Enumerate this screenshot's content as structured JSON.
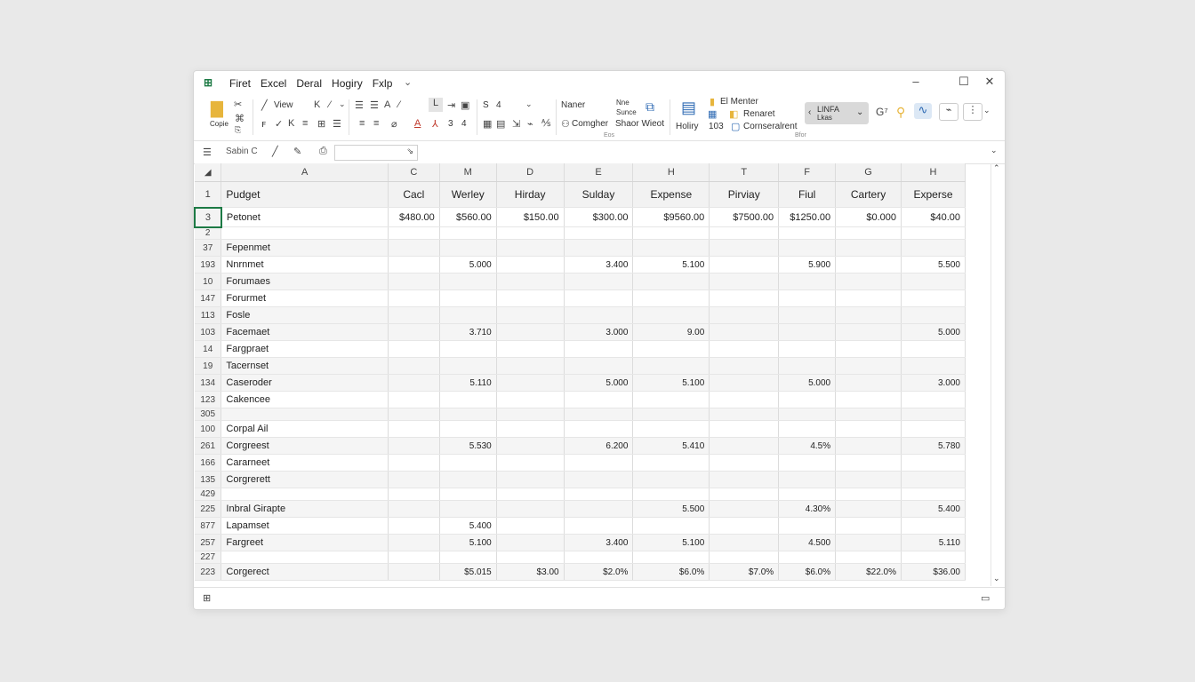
{
  "window": {
    "menu": [
      "Firet",
      "Excel",
      "Deral",
      "Hogiry",
      "Fxlp"
    ],
    "controls": [
      "–",
      "☐",
      "✕"
    ]
  },
  "ribbon": {
    "clipboard_label": "Copie",
    "view_label": "View",
    "name_label": "Naner",
    "computer_label": "Comgher",
    "nine_label": "Nne",
    "share_label": "Sunce",
    "sharewb_label": "Shaor Wieot",
    "holiry_label": "Holiry",
    "num_label": "103",
    "font_nums": [
      "3",
      "4"
    ],
    "align_nums": [
      "S",
      "4"
    ],
    "menter_label": "El Menter",
    "renaret_label": "Renaret",
    "cornserant_label": "Cornseralrent",
    "style_line1": "LINFA",
    "style_line2": "Lkas",
    "group_labels": [
      "Eos",
      "Bfor"
    ]
  },
  "formula_bar": {
    "name_box": "Sabin C"
  },
  "sheet": {
    "columns": [
      "A",
      "C",
      "M",
      "D",
      "E",
      "H",
      "T",
      "F",
      "G",
      "H"
    ],
    "header_row": {
      "num": "1",
      "cells": [
        "Pudget",
        "Cacl",
        "Werley",
        "Hirday",
        "Sulday",
        "Expense",
        "Pirviay",
        "Fiul",
        "Cartery",
        "Experse"
      ]
    },
    "rows": [
      {
        "num": "3",
        "cells": [
          "Petonet",
          "$480.00",
          "$560.00",
          "$150.00",
          "$300.00",
          "$9560.00",
          "$7500.00",
          "$1250.00",
          "$0.000",
          "$40.00"
        ],
        "style": "r2",
        "selected": true
      },
      {
        "num": "2",
        "cells": [
          "",
          "",
          "",
          "",
          "",
          "",
          "",
          "",
          "",
          ""
        ],
        "style": "thin"
      },
      {
        "num": "37",
        "cells": [
          "Fepenmet",
          "",
          "",
          "",
          "",
          "",
          "",
          "",
          "",
          ""
        ],
        "style": "shade"
      },
      {
        "num": "193",
        "cells": [
          "Nnrnmet",
          "",
          "5.000",
          "",
          "3.400",
          "5.100",
          "",
          "5.900",
          "",
          "5.500"
        ],
        "style": "plain"
      },
      {
        "num": "10",
        "cells": [
          "Forumaes",
          "",
          "",
          "",
          "",
          "",
          "",
          "",
          "",
          ""
        ],
        "style": "shade"
      },
      {
        "num": "147",
        "cells": [
          "Forurmet",
          "",
          "",
          "",
          "",
          "",
          "",
          "",
          "",
          ""
        ],
        "style": "plain"
      },
      {
        "num": "113",
        "cells": [
          "Fosle",
          "",
          "",
          "",
          "",
          "",
          "",
          "",
          "",
          ""
        ],
        "style": "shade"
      },
      {
        "num": "103",
        "cells": [
          "Facemaet",
          "",
          "3.710",
          "",
          "3.000",
          "9.00",
          "",
          "",
          "",
          "5.000"
        ],
        "style": "shade"
      },
      {
        "num": "14",
        "cells": [
          "Fargpraet",
          "",
          "",
          "",
          "",
          "",
          "",
          "",
          "",
          ""
        ],
        "style": "plain"
      },
      {
        "num": "19",
        "cells": [
          "Tacernset",
          "",
          "",
          "",
          "",
          "",
          "",
          "",
          "",
          ""
        ],
        "style": "shade"
      },
      {
        "num": "134",
        "cells": [
          "Caseroder",
          "",
          "5.110",
          "",
          "5.000",
          "5.100",
          "",
          "5.000",
          "",
          "3.000"
        ],
        "style": "shade"
      },
      {
        "num": "123",
        "cells": [
          "Cakencee",
          "",
          "",
          "",
          "",
          "",
          "",
          "",
          "",
          ""
        ],
        "style": "plain"
      },
      {
        "num": "305",
        "cells": [
          "",
          "",
          "",
          "",
          "",
          "",
          "",
          "",
          "",
          ""
        ],
        "style": "thinshade"
      },
      {
        "num": "100",
        "cells": [
          "Corpal Ail",
          "",
          "",
          "",
          "",
          "",
          "",
          "",
          "",
          ""
        ],
        "style": "plain"
      },
      {
        "num": "261",
        "cells": [
          "Corgreest",
          "",
          "5.530",
          "",
          "6.200",
          "5.410",
          "",
          "4.5%",
          "",
          "5.780"
        ],
        "style": "shade"
      },
      {
        "num": "166",
        "cells": [
          "Cararneet",
          "",
          "",
          "",
          "",
          "",
          "",
          "",
          "",
          ""
        ],
        "style": "plain"
      },
      {
        "num": "135",
        "cells": [
          "Corgrerett",
          "",
          "",
          "",
          "",
          "",
          "",
          "",
          "",
          ""
        ],
        "style": "shade"
      },
      {
        "num": "429",
        "cells": [
          "",
          "",
          "",
          "",
          "",
          "",
          "",
          "",
          "",
          ""
        ],
        "style": "thin"
      },
      {
        "num": "225",
        "cells": [
          "Inbral Girapte",
          "",
          "",
          "",
          "",
          "5.500",
          "",
          "4.30%",
          "",
          "5.400"
        ],
        "style": "shade"
      },
      {
        "num": "877",
        "cells": [
          "Lapamset",
          "",
          "5.400",
          "",
          "",
          "",
          "",
          "",
          "",
          ""
        ],
        "style": "plain"
      },
      {
        "num": "257",
        "cells": [
          "Fargreet",
          "",
          "5.100",
          "",
          "3.400",
          "5.100",
          "",
          "4.500",
          "",
          "5.110"
        ],
        "style": "shade"
      },
      {
        "num": "227",
        "cells": [
          "",
          "",
          "",
          "",
          "",
          "",
          "",
          "",
          "",
          ""
        ],
        "style": "thin"
      },
      {
        "num": "223",
        "cells": [
          "Corgerect",
          "",
          "$5.015",
          "$3.00",
          "$2.0%",
          "$6.0%",
          "$7.0%",
          "$6.0%",
          "$22.0%",
          "$36.00"
        ],
        "style": "shade"
      }
    ]
  },
  "colors": {
    "accent": "#1d7a45",
    "grid_line": "#dcdcdc",
    "row_shade": "#f5f5f5"
  }
}
